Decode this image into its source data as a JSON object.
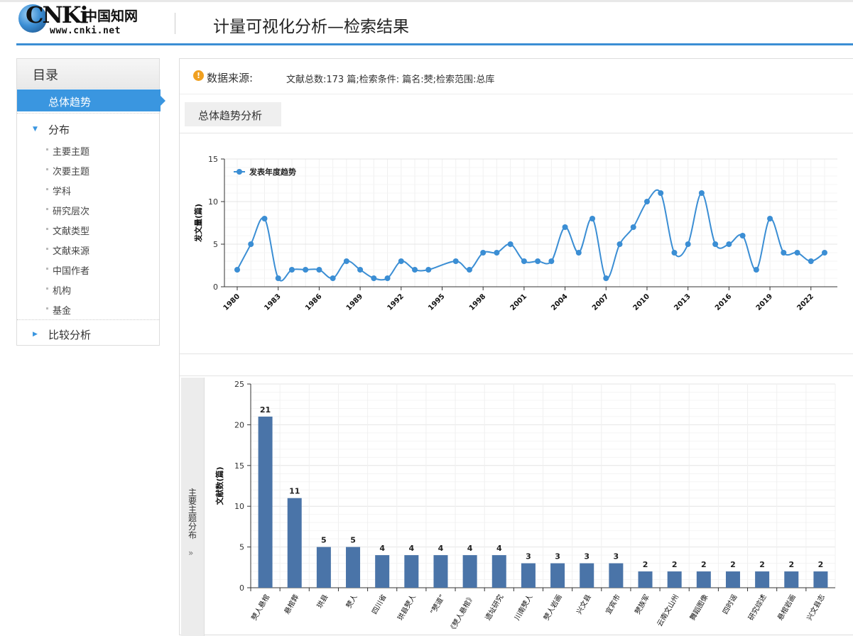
{
  "header": {
    "logo_brand": "CNKi",
    "logo_cn": "中国知网",
    "logo_url": "www.cnki.net",
    "title": "计量可视化分析—检索结果"
  },
  "sidebar": {
    "heading": "目录",
    "active_item": "总体趋势",
    "groups": [
      {
        "label": "分布",
        "expanded": true,
        "items": [
          "主要主题",
          "次要主题",
          "学科",
          "研究层次",
          "文献类型",
          "文献来源",
          "中国作者",
          "机构",
          "基金"
        ]
      },
      {
        "label": "比较分析",
        "expanded": false,
        "items": []
      }
    ]
  },
  "main": {
    "source_label": "数据来源:",
    "source_info": "文献总数:173 篇;检索条件: 篇名:僰;检索范围:总库",
    "tab_label": "总体趋势分析",
    "side_tab_label": "主要主题分布",
    "side_tab_arrow": "»"
  },
  "colors": {
    "accent": "#3a96e0",
    "line": "#3b8ed4",
    "bar": "#4a74a8",
    "warning": "#f0a020"
  },
  "chart_data": [
    {
      "type": "line",
      "ylabel": "发文量(篇)",
      "legend": "发表年度趋势",
      "legend_position": "top-left",
      "ylim": [
        0,
        15
      ],
      "yticks": [
        0,
        5,
        10,
        15
      ],
      "x": [
        1980,
        1981,
        1982,
        1983,
        1984,
        1985,
        1986,
        1987,
        1988,
        1989,
        1990,
        1991,
        1992,
        1993,
        1994,
        1995,
        1996,
        1997,
        1998,
        1999,
        2000,
        2001,
        2002,
        2003,
        2004,
        2005,
        2006,
        2007,
        2008,
        2009,
        2010,
        2011,
        2012,
        2013,
        2014,
        2015,
        2016,
        2017,
        2018,
        2019,
        2020,
        2021,
        2022,
        2023
      ],
      "xticks": [
        "1980",
        "1983",
        "1986",
        "1989",
        "1992",
        "1995",
        "1998",
        "2001",
        "2004",
        "2007",
        "2010",
        "2013",
        "2016",
        "2019",
        "2022"
      ],
      "series": [
        {
          "name": "发表年度趋势",
          "values": [
            2,
            5,
            8,
            1,
            2,
            2,
            2,
            1,
            3,
            2,
            1,
            1,
            3,
            2,
            2,
            null,
            3,
            2,
            4,
            4,
            5,
            3,
            3,
            3,
            7,
            4,
            8,
            1,
            5,
            7,
            10,
            11,
            4,
            5,
            11,
            5,
            5,
            6,
            2,
            8,
            4,
            4,
            3,
            4
          ]
        }
      ],
      "grid": true
    },
    {
      "type": "bar",
      "ylabel": "文献数(篇)",
      "ylim": [
        0,
        25
      ],
      "yticks": [
        0,
        5,
        10,
        15,
        20,
        25
      ],
      "categories": [
        "僰人悬棺",
        "悬棺葬",
        "珙县",
        "僰人",
        "四川省",
        "珙县僰人",
        "“僰道”",
        "《僰人悬棺》",
        "遗址研究",
        "川南僰人",
        "僰人岩画",
        "兴文县",
        "宜宾市",
        "僰族军",
        "云南文山州",
        "舞蹈图像",
        "四时谣",
        "研究综述",
        "悬棺岩画",
        "兴文县志"
      ],
      "values": [
        21,
        11,
        5,
        5,
        4,
        4,
        4,
        4,
        4,
        3,
        3,
        3,
        3,
        2,
        2,
        2,
        2,
        2,
        2,
        2
      ],
      "grid": true
    }
  ]
}
